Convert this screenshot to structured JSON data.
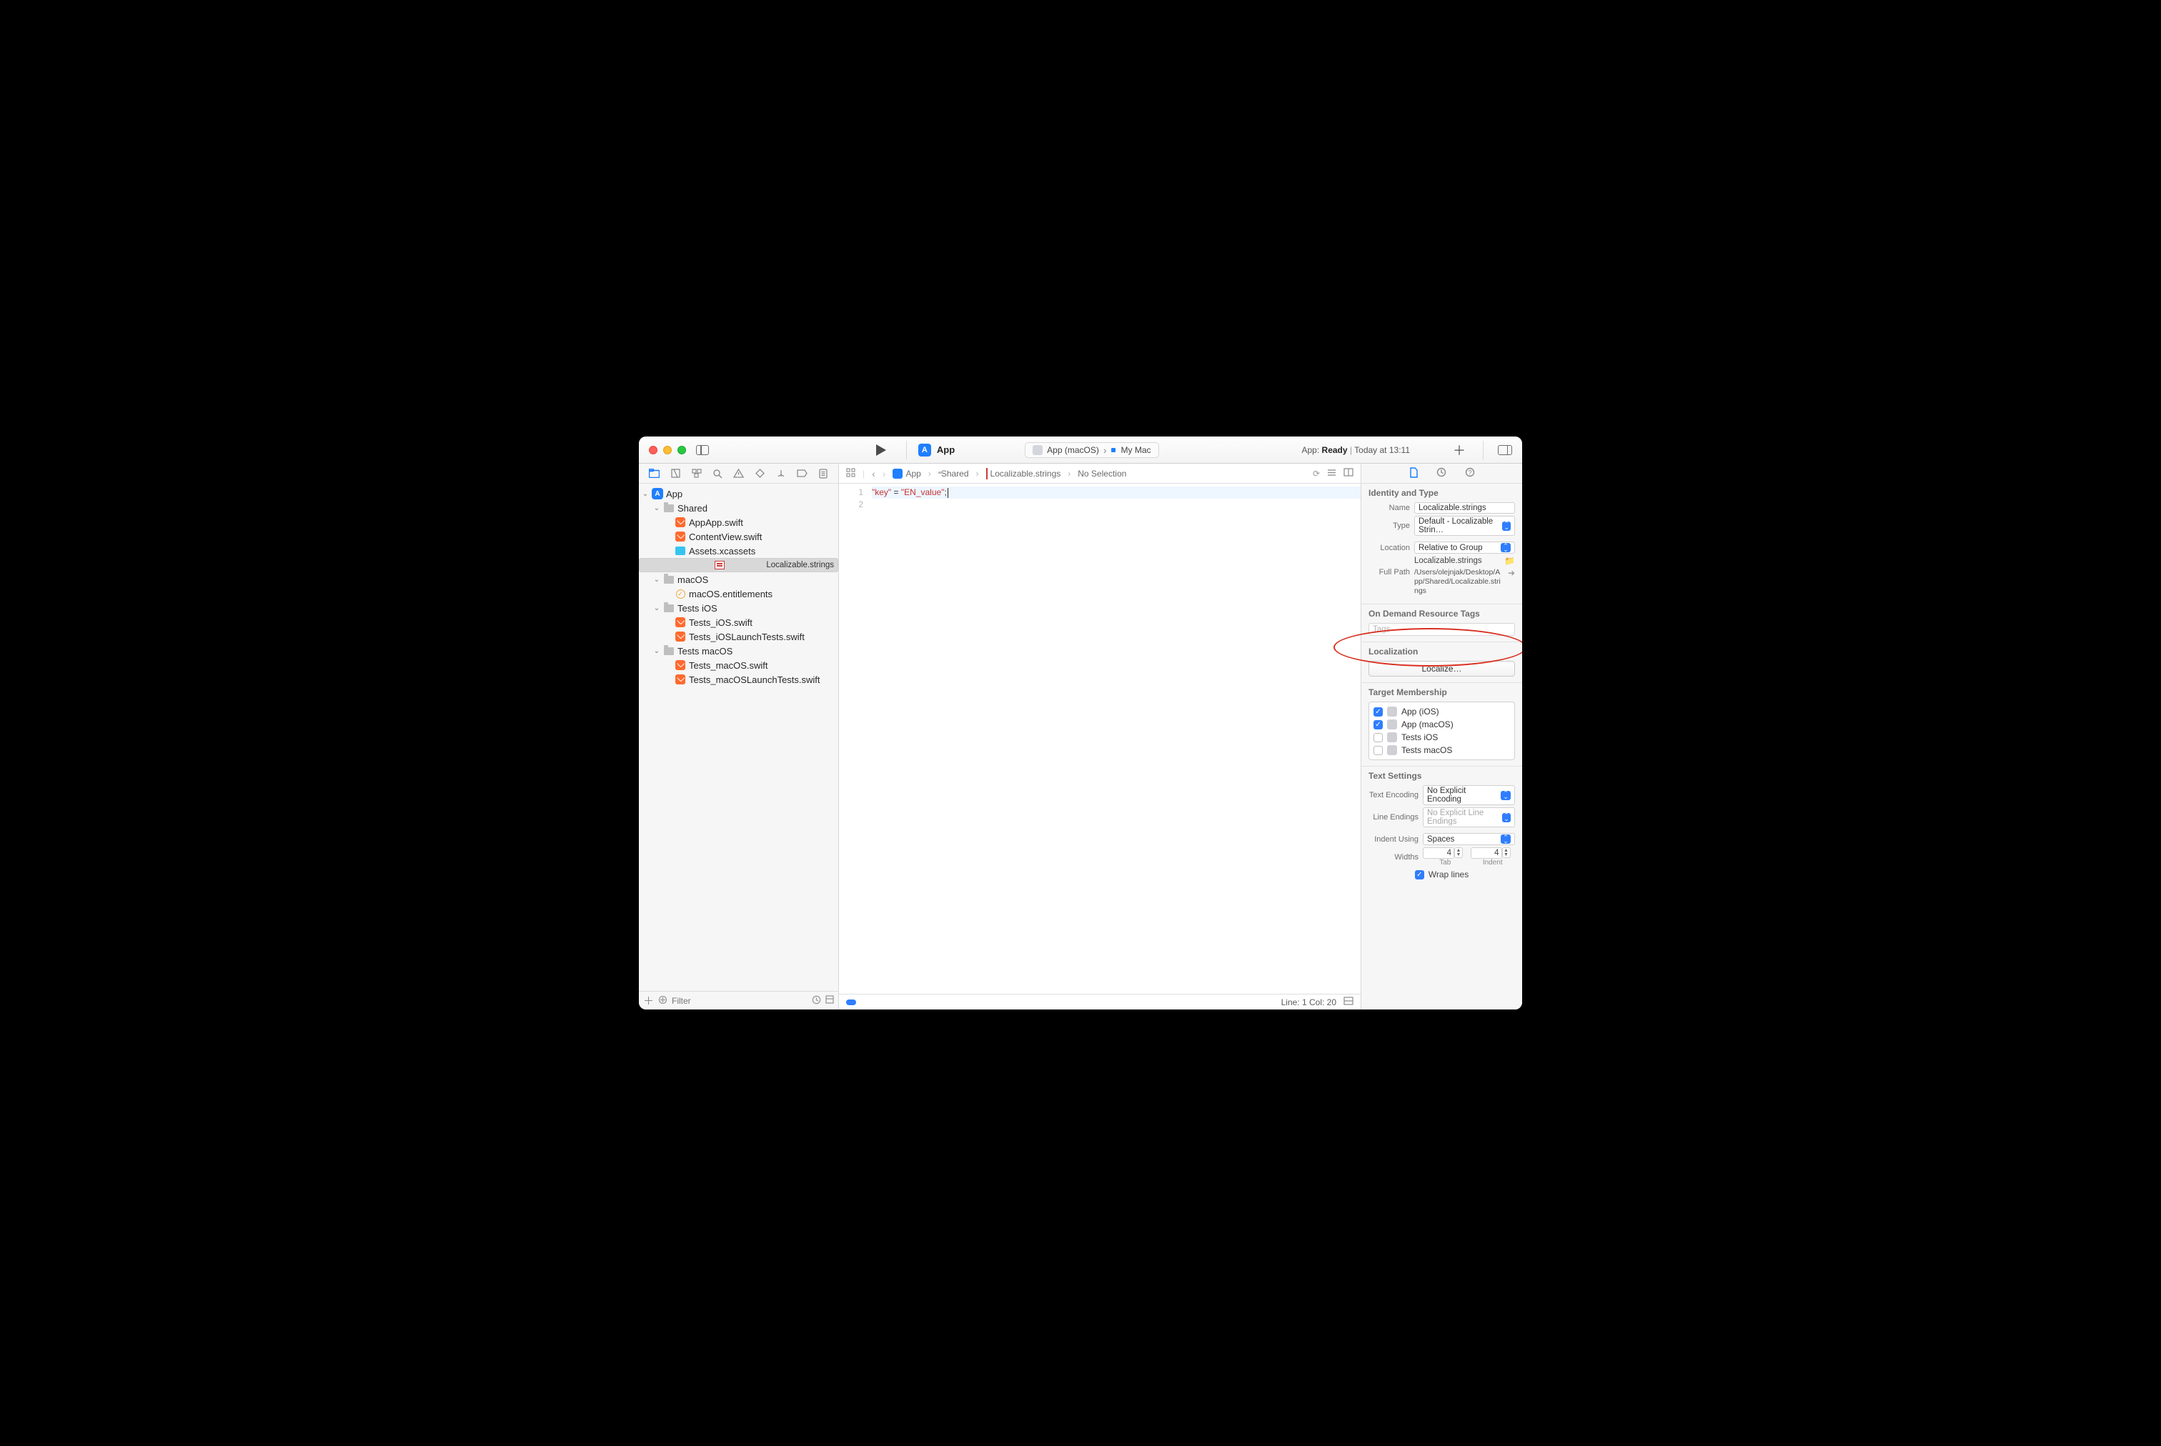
{
  "toolbar": {
    "scheme_project": "App",
    "scheme_target": "App (macOS)",
    "scheme_destination": "My Mac",
    "status_prefix": "App:",
    "status_state": "Ready",
    "status_time": "Today at 13:11"
  },
  "breadcrumb": {
    "items": [
      "App",
      "Shared",
      "Localizable.strings",
      "No Selection"
    ]
  },
  "navigator": {
    "project": "App",
    "tree": [
      {
        "label": "App",
        "kind": "project",
        "depth": 0,
        "expanded": true
      },
      {
        "label": "Shared",
        "kind": "folder",
        "depth": 1,
        "expanded": true
      },
      {
        "label": "AppApp.swift",
        "kind": "swift",
        "depth": 2
      },
      {
        "label": "ContentView.swift",
        "kind": "swift",
        "depth": 2
      },
      {
        "label": "Assets.xcassets",
        "kind": "assets",
        "depth": 2
      },
      {
        "label": "Localizable.strings",
        "kind": "strings",
        "depth": 2,
        "selected": true
      },
      {
        "label": "macOS",
        "kind": "folder",
        "depth": 1,
        "expanded": true
      },
      {
        "label": "macOS.entitlements",
        "kind": "entitlements",
        "depth": 2
      },
      {
        "label": "Tests iOS",
        "kind": "folder",
        "depth": 1,
        "expanded": true
      },
      {
        "label": "Tests_iOS.swift",
        "kind": "swift",
        "depth": 2
      },
      {
        "label": "Tests_iOSLaunchTests.swift",
        "kind": "swift",
        "depth": 2
      },
      {
        "label": "Tests macOS",
        "kind": "folder",
        "depth": 1,
        "expanded": true
      },
      {
        "label": "Tests_macOS.swift",
        "kind": "swift",
        "depth": 2
      },
      {
        "label": "Tests_macOSLaunchTests.swift",
        "kind": "swift",
        "depth": 2
      }
    ],
    "filter_placeholder": "Filter"
  },
  "editor": {
    "line1_key": "\"key\"",
    "line1_eq": " = ",
    "line1_val": "\"EN_value\"",
    "line1_semi": ";",
    "status": "Line: 1  Col: 20",
    "gutter": [
      "1",
      "2"
    ]
  },
  "inspector": {
    "identity_header": "Identity and Type",
    "name_label": "Name",
    "name_value": "Localizable.strings",
    "type_label": "Type",
    "type_value": "Default - Localizable Strin…",
    "location_label": "Location",
    "location_value": "Relative to Group",
    "location_file": "Localizable.strings",
    "fullpath_label": "Full Path",
    "fullpath_value": "/Users/olejnjak/Desktop/App/Shared/Localizable.strings",
    "odr_header": "On Demand Resource Tags",
    "odr_placeholder": "Tags",
    "loc_header": "Localization",
    "loc_button": "Localize…",
    "tm_header": "Target Membership",
    "tm_items": [
      {
        "label": "App (iOS)",
        "checked": true
      },
      {
        "label": "App (macOS)",
        "checked": true
      },
      {
        "label": "Tests iOS",
        "checked": false
      },
      {
        "label": "Tests macOS",
        "checked": false
      }
    ],
    "ts_header": "Text Settings",
    "te_label": "Text Encoding",
    "te_value": "No Explicit Encoding",
    "le_label": "Line Endings",
    "le_value": "No Explicit Line Endings",
    "iu_label": "Indent Using",
    "iu_value": "Spaces",
    "widths_label": "Widths",
    "tab_width": "4",
    "indent_width": "4",
    "tab_sub": "Tab",
    "indent_sub": "Indent",
    "wrap_label": "Wrap lines",
    "wrap_checked": true
  }
}
